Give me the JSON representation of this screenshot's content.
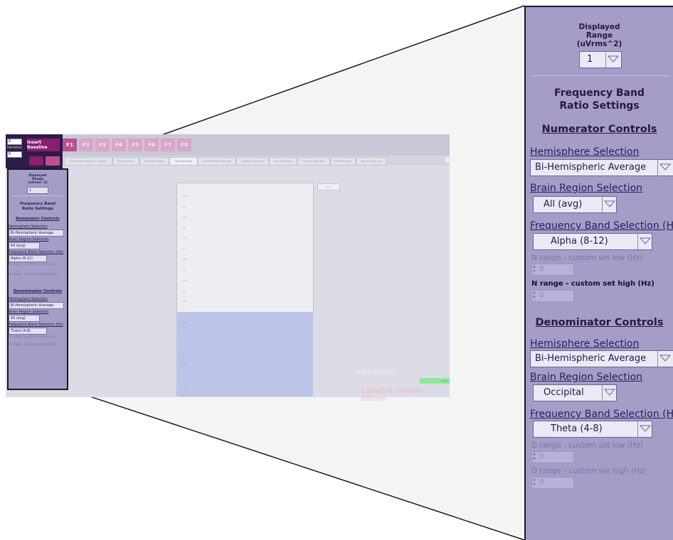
{
  "mini": {
    "fields": [
      "0",
      "0"
    ],
    "field_label": "Iteration",
    "insert_label": "Insert Baseline",
    "fkeys": [
      "F1",
      "F2",
      "F3",
      "F4",
      "F5",
      "F6",
      "F7",
      "F8"
    ],
    "tabs": [
      "Homepage Display & Triggers",
      "Plasma Index",
      "Electrode Offset",
      "Spectral Band",
      "Event Related Average",
      "Auditory Stimulus",
      "Live Operation",
      "Playing Seek Box",
      "EEG Montage",
      "Neuro Audio Log"
    ],
    "y_ticks": [
      "1",
      "0.95",
      "0.9",
      "0.85",
      "0.8",
      "0.75",
      "0.7",
      "0.65",
      "0.6",
      "0.55",
      "0.5",
      "0.45",
      "0.4",
      "0.35",
      "0.3",
      "0.25",
      "0.2",
      "0.15",
      "0.1",
      "0.05",
      "0"
    ],
    "legend": "Plot 0",
    "panel": {
      "range_title": [
        "Displayed",
        "Range",
        "(uVrms^2)"
      ],
      "range_value": "1",
      "freq_title": [
        "Frequency Band",
        "Ratio Settings"
      ],
      "numerator_title": "Numerator Controls",
      "num_hemisphere_label": "Hemisphere Selection",
      "num_hemisphere_value": "Bi-Hemispheric Average",
      "num_region_label": "Brain Region Selection",
      "num_region_value": "All (avg)",
      "num_band_label": "Frequency Band Selection (Hz)",
      "num_band_value": "Alpha (8-12)",
      "num_low_label": "N range - custom set low (Hz)",
      "num_high_label": "N range - custom set high (Hz)",
      "denominator_title": "Denominator Controls",
      "den_hemisphere_label": "Hemisphere Selection",
      "den_hemisphere_value": "Bi-Hemispheric Average",
      "den_region_label": "Brain Region Selection",
      "den_region_value": "All (avg)",
      "den_band_label": "Frequency Band Selection (Hz)",
      "den_band_value": "Theta (4-8)",
      "den_low_label": "D range - custom set low (Hz)",
      "den_high_label": "D range - custom set high (Hz)"
    },
    "ni": [
      "NATIONAL",
      "INSTRUMENTS",
      "LabVIEW Student Edition"
    ],
    "status": "Online"
  },
  "panel": {
    "range_title": [
      "Displayed",
      "Range",
      "(uVrms^2)"
    ],
    "range_value": "1",
    "freq_title": [
      "Frequency Band",
      "Ratio Settings"
    ],
    "numerator_title": "Numerator Controls",
    "num_hemisphere_label": "Hemisphere Selection",
    "num_hemisphere_value": "Bi-Hemispheric Average",
    "num_region_label": "Brain Region Selection",
    "num_region_value": "All (avg)",
    "num_band_label": "Frequency Band Selection (Hz)",
    "num_band_value": "Alpha (8-12)",
    "num_low_label": "N range - custom set low (Hz)",
    "num_low_value": "0",
    "num_high_label": "N range - custom set high (Hz)",
    "num_high_value": "0",
    "denominator_title": "Denominator Controls",
    "den_hemisphere_label": "Hemisphere Selection",
    "den_hemisphere_value": "Bi-Hemispheric Average",
    "den_region_label": "Brain Region Selection",
    "den_region_value": "Occipital",
    "den_band_label": "Frequency Band Selection (Hz)",
    "den_band_value": "Theta (4-8)",
    "den_low_label": "D range - custom set low (Hz)",
    "den_low_value": "0",
    "den_high_label": "D range - custom set high (Hz)",
    "den_high_value": "0"
  },
  "colors": {
    "panel_bg": "#a59cc8",
    "header_dark": "#2e1b4a",
    "insert_button": "#8b1e6f",
    "fkey": "#b9528f",
    "chart_bar": "#bcc4e8"
  }
}
